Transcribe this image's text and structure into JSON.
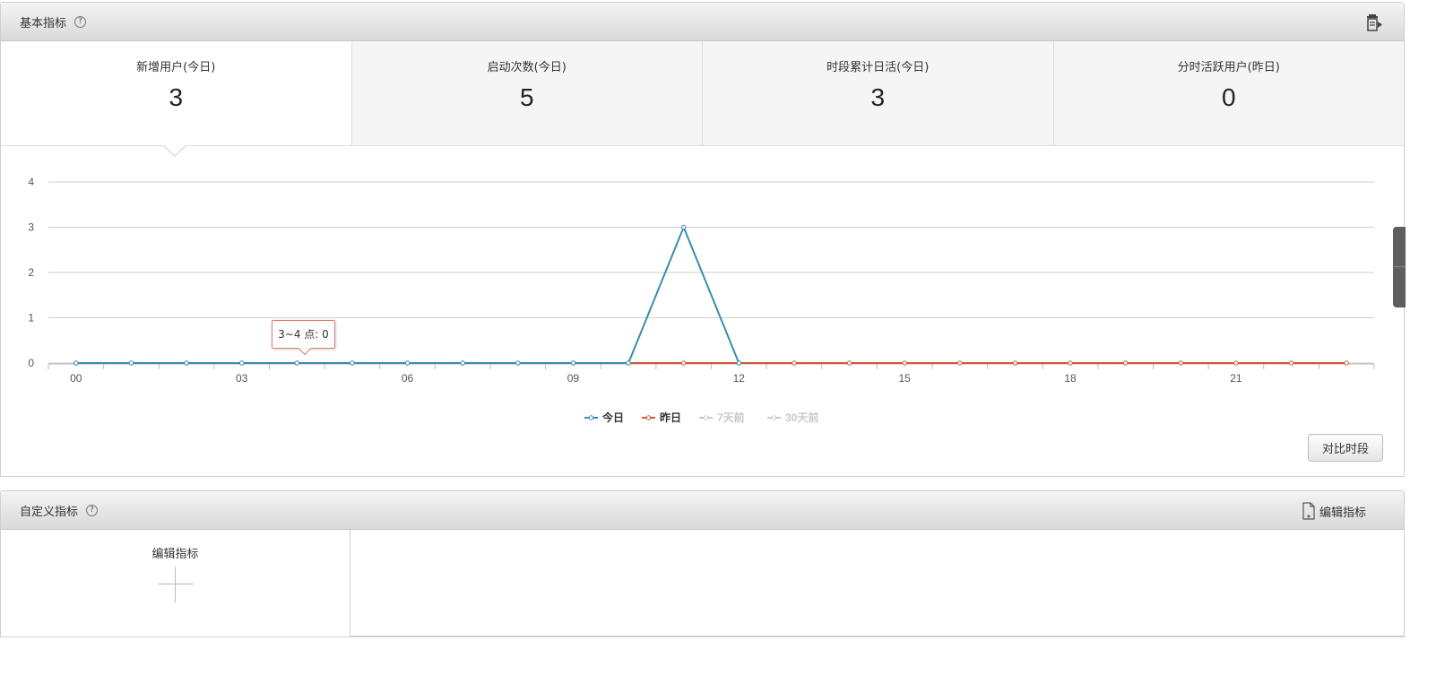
{
  "basic": {
    "title": "基本指标",
    "help": "?",
    "kpis": [
      {
        "label": "新增用户(今日)",
        "value": "3"
      },
      {
        "label": "启动次数(今日)",
        "value": "5"
      },
      {
        "label": "时段累计日活(今日)",
        "value": "3"
      },
      {
        "label": "分时活跃用户(昨日)",
        "value": "0"
      }
    ],
    "tooltip": "3~4 点: 0",
    "compare_button": "对比时段"
  },
  "chart_data": {
    "type": "line",
    "x": [
      0,
      1,
      2,
      3,
      4,
      5,
      6,
      7,
      8,
      9,
      10,
      11,
      12,
      13,
      14,
      15,
      16,
      17,
      18,
      19,
      20,
      21,
      22,
      23
    ],
    "xtick_labels": [
      "00",
      "03",
      "06",
      "09",
      "12",
      "15",
      "18",
      "21"
    ],
    "ylim": [
      0,
      4
    ],
    "yticks": [
      "0",
      "1",
      "2",
      "3",
      "4"
    ],
    "grid": true,
    "legend_position": "bottom-center",
    "series": [
      {
        "name": "今日",
        "color": "#3b8bb0",
        "active": true,
        "values": [
          0,
          0,
          0,
          0,
          0,
          0,
          0,
          0,
          0,
          0,
          0,
          3,
          0
        ]
      },
      {
        "name": "昨日",
        "color": "#d0573a",
        "active": true,
        "values": [
          0,
          0,
          0,
          0,
          0,
          0,
          0,
          0,
          0,
          0,
          0,
          0,
          0,
          0,
          0,
          0,
          0,
          0,
          0,
          0,
          0,
          0,
          0,
          0
        ]
      },
      {
        "name": "7天前",
        "color": "#c8c8c8",
        "active": false,
        "values": []
      },
      {
        "name": "30天前",
        "color": "#c8c8c8",
        "active": false,
        "values": []
      }
    ]
  },
  "custom": {
    "title": "自定义指标",
    "help": "?",
    "edit_link": "编辑指标",
    "add_label": "编辑指标"
  }
}
